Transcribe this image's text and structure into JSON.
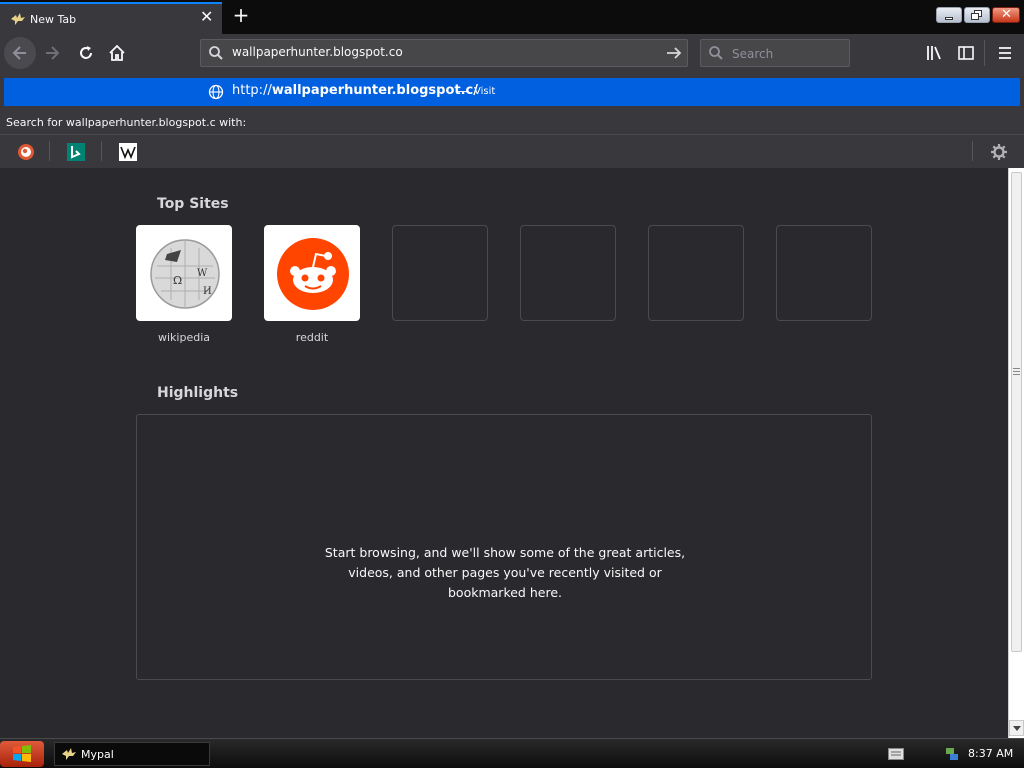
{
  "tab": {
    "title": "New Tab"
  },
  "urlbar": {
    "value": "wallpaperhunter.blogspot.co"
  },
  "searchbar": {
    "placeholder": "Search"
  },
  "popup": {
    "suggestion_prefix": "http://",
    "suggestion_url": "wallpaperhunter.blogspot.c/",
    "suggestion_dash": "—",
    "suggestion_action": "Visit",
    "search_with": "Search for wallpaperhunter.blogspot.c with:"
  },
  "content": {
    "top_sites_title": "Top Sites",
    "sites": [
      {
        "label": "wikipedia"
      },
      {
        "label": "reddit"
      }
    ],
    "highlights_title": "Highlights",
    "highlights_message": "Start browsing, and we'll show some of the great articles, videos, and other pages you've recently visited or bookmarked here."
  },
  "taskbar": {
    "app_label": "Mypal",
    "clock": "8:37 AM"
  },
  "colors": {
    "accent": "#0060df",
    "background": "#2a2a2e",
    "toolbar": "#38383d"
  }
}
